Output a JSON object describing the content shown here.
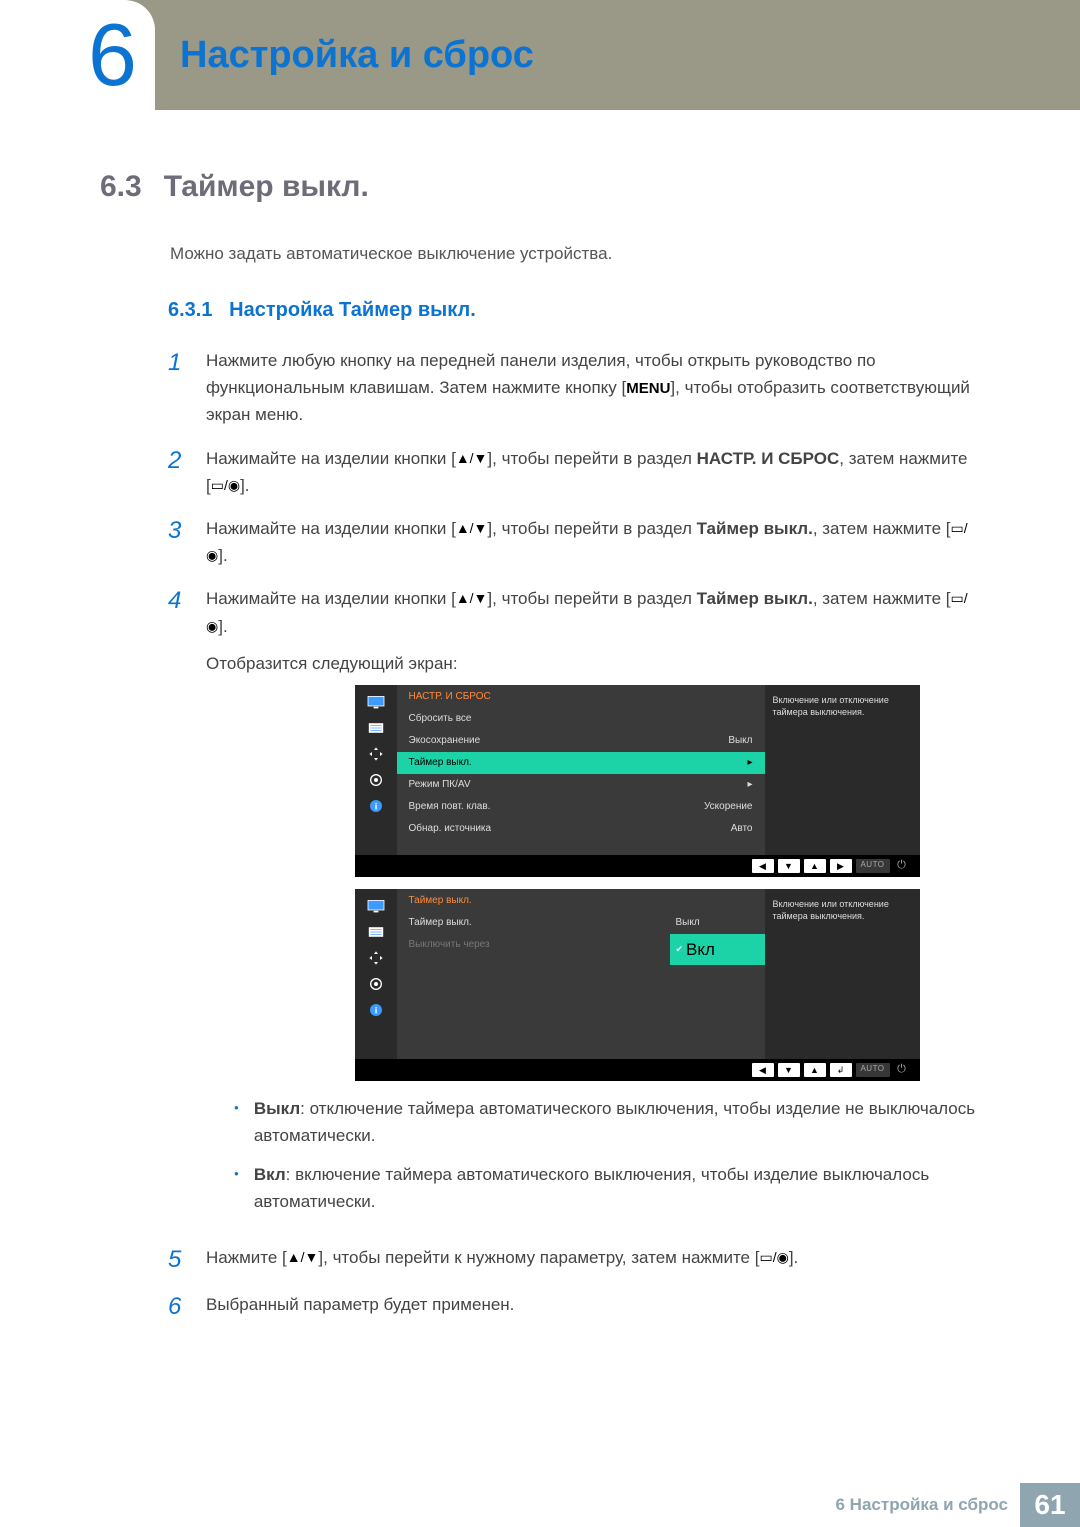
{
  "header": {
    "chapter_number": "6",
    "chapter_title": "Настройка и сброс"
  },
  "section": {
    "number": "6.3",
    "title": "Таймер выкл.",
    "intro": "Можно задать автоматическое выключение устройства.",
    "sub_number": "6.3.1",
    "sub_title": "Настройка Таймер выкл."
  },
  "steps": {
    "s1_a": "Нажмите любую кнопку на передней панели изделия, чтобы открыть руководство по функциональным клавишам. Затем нажмите кнопку [",
    "s1_menu": "MENU",
    "s1_b": "], чтобы отобразить соответствующий экран меню.",
    "s2_a": "Нажимайте на изделии кнопки [",
    "s2_icons": "▲/▼",
    "s2_b": "], чтобы перейти в раздел ",
    "s2_target": "НАСТР. И СБРОС",
    "s2_c": ", затем нажмите [",
    "s2_icons2": "▭/◉",
    "s2_d": "].",
    "s3_a": "Нажимайте на изделии кнопки [",
    "s3_icons": "▲/▼",
    "s3_b": "], чтобы перейти в раздел ",
    "s3_target": "Таймер выкл.",
    "s3_c": ", затем нажмите [",
    "s3_icons2": "▭/◉",
    "s3_d": "].",
    "s4_a": "Нажимайте на изделии кнопки [",
    "s4_icons": "▲/▼",
    "s4_b": "], чтобы перейти в раздел ",
    "s4_target": "Таймер выкл.",
    "s4_c": ", затем нажмите [",
    "s4_icons2": "▭/◉",
    "s4_d": "].",
    "s4_after": "Отобразится следующий экран:",
    "s5_a": "Нажмите [",
    "s5_icons": "▲/▼",
    "s5_b": "], чтобы перейти к нужному параметру, затем нажмите [",
    "s5_icons2": "▭/◉",
    "s5_c": "].",
    "s6": "Выбранный параметр будет применен."
  },
  "osd1": {
    "title": "НАСТР. И СБРОС",
    "rows": [
      {
        "l": "Сбросить все",
        "r": ""
      },
      {
        "l": "Экосохранение",
        "r": "Выкл"
      },
      {
        "l": "Таймер выкл.",
        "r": "▸",
        "selected": true
      },
      {
        "l": "Режим ПК/AV",
        "r": "▸"
      },
      {
        "l": "Время повт. клав.",
        "r": "Ускорение"
      },
      {
        "l": "Обнар. источника",
        "r": "Авто"
      }
    ],
    "help": "Включение или отключение таймера выключения.",
    "footer": {
      "left": "◀",
      "down": "▼",
      "up": "▲",
      "right": "▶",
      "auto": "AUTO",
      "power": "⏻"
    }
  },
  "osd2": {
    "title": "Таймер выкл.",
    "rows_left": [
      {
        "l": "Таймер выкл."
      },
      {
        "l": "Выключить через",
        "inactive": true
      }
    ],
    "rows_right": [
      {
        "l": "Выкл"
      },
      {
        "l": "Вкл",
        "selected": true
      }
    ],
    "help": "Включение или отключение таймера выключения.",
    "footer": {
      "left": "◀",
      "down": "▼",
      "up": "▲",
      "enter": "↲",
      "auto": "AUTO",
      "power": "⏻"
    }
  },
  "bullets": {
    "b1_head": "Выкл",
    "b1_text": ": отключение таймера автоматического выключения, чтобы изделие не выключалось автоматически.",
    "b2_head": "Вкл",
    "b2_text": ": включение таймера автоматического выключения, чтобы изделие выключалось автоматически."
  },
  "footer": {
    "text": "6 Настройка и сброс",
    "page": "61"
  },
  "icons": {
    "monitor": "monitor",
    "list": "list",
    "arrows": "arrows",
    "gear": "gear",
    "info": "info"
  }
}
